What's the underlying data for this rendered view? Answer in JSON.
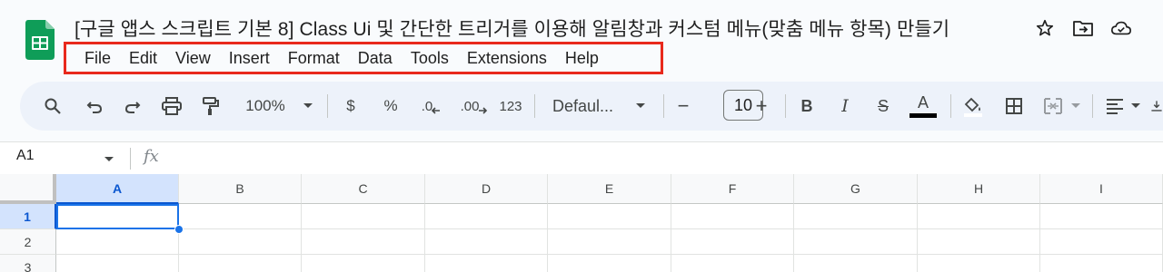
{
  "document": {
    "title": "[구글 앱스 스크립트 기본 8] Class Ui 및 간단한 트리거를 이용해 알림창과 커스텀 메뉴(맞춤 메뉴 항목) 만들기",
    "logo": "google-sheets-logo",
    "title_icons": [
      "star-icon",
      "move-to-folder-icon",
      "cloud-status-icon"
    ]
  },
  "menubar": {
    "highlight_color": "#e8291c",
    "items": [
      "File",
      "Edit",
      "View",
      "Insert",
      "Format",
      "Data",
      "Tools",
      "Extensions",
      "Help"
    ]
  },
  "toolbar": {
    "zoom": "100%",
    "currency": "$",
    "percent": "%",
    "decrease_decimal": ".0",
    "increase_decimal": ".00",
    "number_format": "123",
    "font_family": "Defaul...",
    "font_size": "10",
    "decrease_font": "−",
    "increase_font": "+",
    "bold": "B",
    "italic": "I",
    "strikethrough": "S",
    "text_color_letter": "A",
    "text_color_bar": "#000000"
  },
  "formula_bar": {
    "cell_ref": "A1",
    "fx": "fx"
  },
  "grid": {
    "columns": [
      "A",
      "B",
      "C",
      "D",
      "E",
      "F",
      "G",
      "H",
      "I"
    ],
    "rows": [
      "1",
      "2",
      "3"
    ],
    "active_column": "A",
    "active_row": "1",
    "selection_color": "#1a73e8"
  }
}
